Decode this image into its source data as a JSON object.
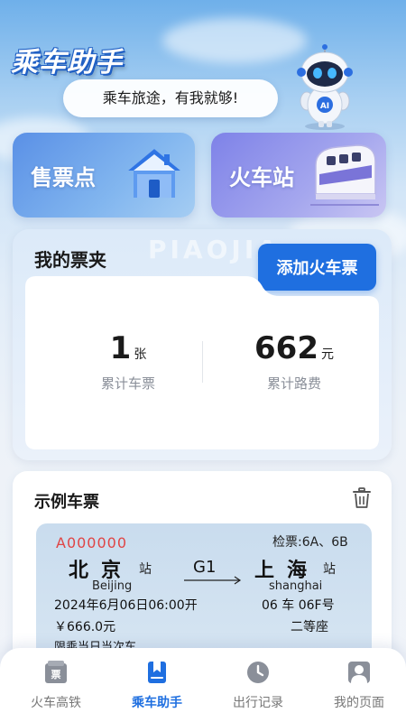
{
  "header": {
    "app_title": "乘车助手",
    "slogan": "乘车旅途，有我就够!",
    "robot_badge": "AI"
  },
  "quick_entries": [
    {
      "label": "售票点",
      "icon": "house-icon"
    },
    {
      "label": "火车站",
      "icon": "train-icon"
    }
  ],
  "wallet": {
    "title": "我的票夹",
    "watermark": "PIAOJIA",
    "add_button": "添加火车票",
    "stats": [
      {
        "value": "1",
        "unit": "张",
        "caption": "累计车票"
      },
      {
        "value": "662",
        "unit": "元",
        "caption": "累计路费"
      }
    ]
  },
  "sample_ticket": {
    "title": "示例车票",
    "ticket_no": "A000000",
    "gate": "检票:6A、6B",
    "from_station": "北京",
    "station_suffix": "站",
    "from_pinyin": "Beijing",
    "train_no": "G1",
    "to_station": "上海",
    "to_pinyin": "shanghai",
    "datetime": "2024年6月06日06:00开",
    "seat": "06 车 06F号",
    "price": "￥666.0元",
    "seat_class": "二等座",
    "note": "限乘当日当次车"
  },
  "bottom_nav": {
    "items": [
      {
        "label": "火车高铁",
        "icon": "ticket-icon",
        "active": false
      },
      {
        "label": "乘车助手",
        "icon": "bookmark-book-icon",
        "active": true
      },
      {
        "label": "出行记录",
        "icon": "clock-icon",
        "active": false
      },
      {
        "label": "我的页面",
        "icon": "person-icon",
        "active": false
      }
    ]
  },
  "colors": {
    "accent": "#1f6fe0",
    "ticket_no": "#e04545",
    "inactive_nav": "#777777"
  }
}
